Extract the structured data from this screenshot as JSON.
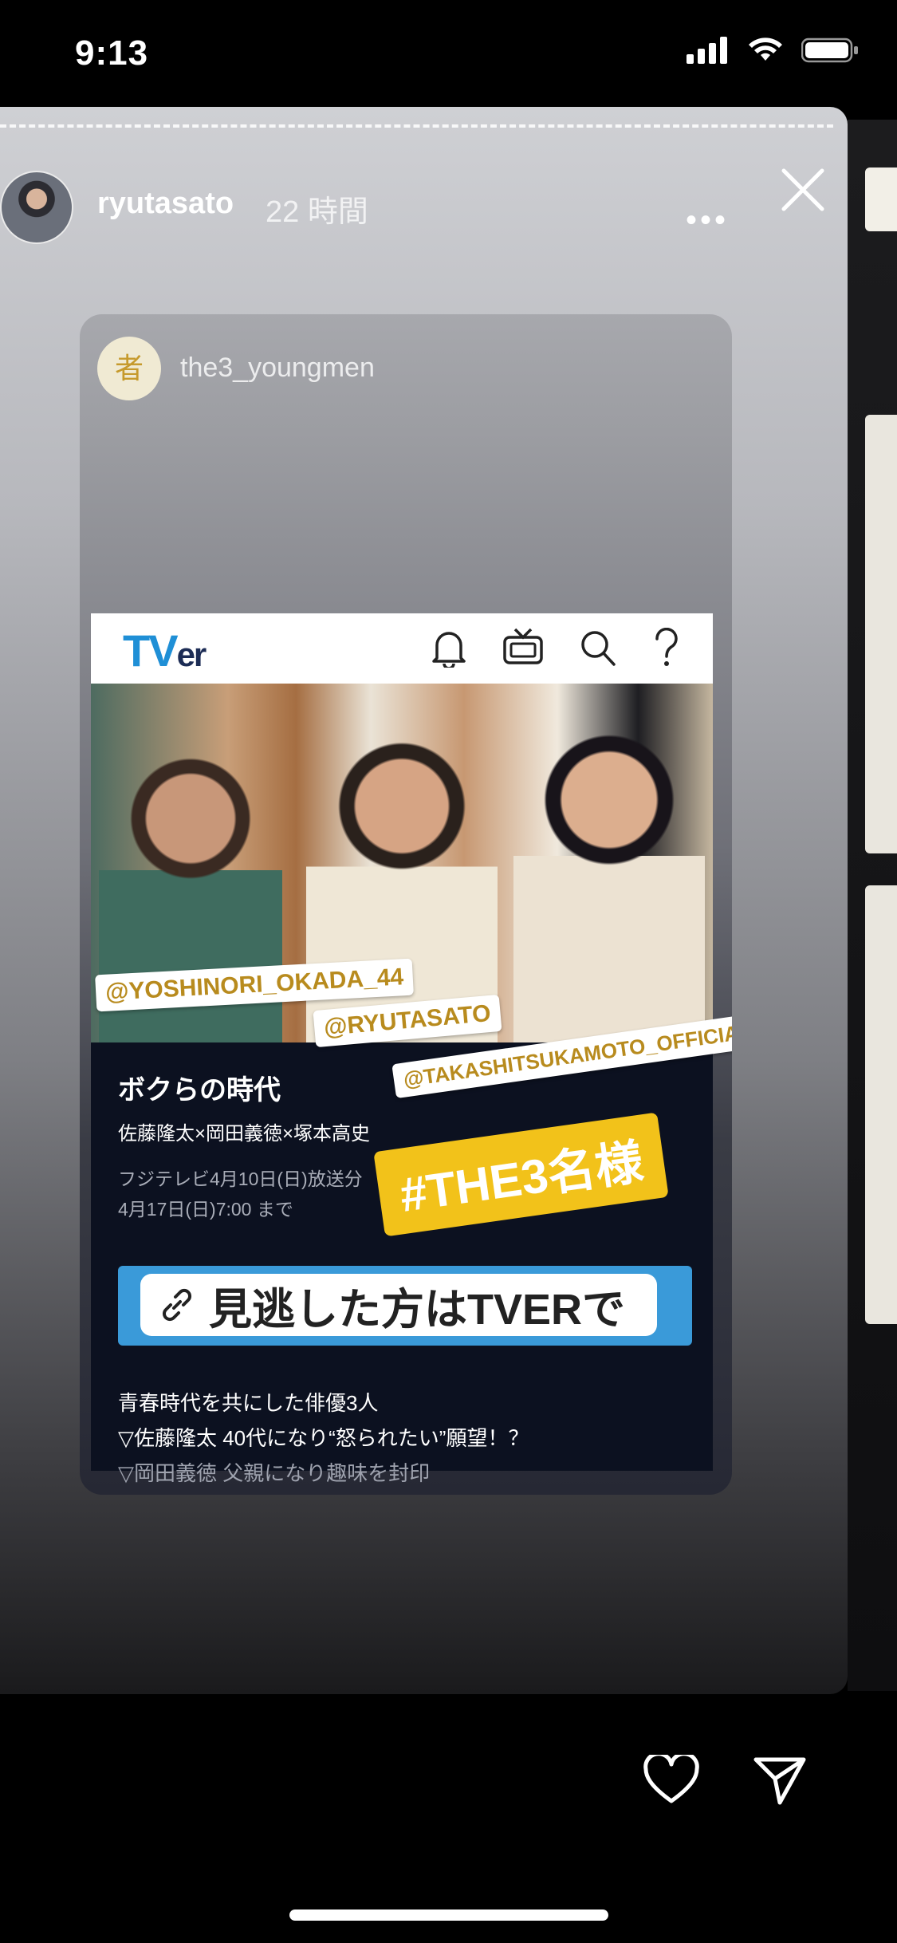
{
  "status_bar": {
    "time": "9:13"
  },
  "story": {
    "username": "ryutasato",
    "elapsed": "22 時間",
    "more_label": "•••"
  },
  "shared_post": {
    "account": "the3_youngmen",
    "account_avatar_glyph": "者"
  },
  "tver": {
    "logo_main": "TV",
    "logo_sub": "er",
    "icons": [
      "bell-icon",
      "tv-icon",
      "search-icon",
      "help-icon"
    ],
    "tags": [
      "@YOSHINORI_OKADA_44",
      "@RYUTASATO",
      "@TAKASHITSUKAMOTO_OFFICIAL"
    ],
    "show_title": "ボクらの時代",
    "cast": "佐藤隆太×岡田義徳×塚本高史",
    "broadcast_line1": "フジテレビ4月10日(日)放送分",
    "broadcast_line2": "4月17日(日)7:00 まで",
    "hashtag": "#THE3名様",
    "link_text": "見逃した方はTVERで",
    "description": [
      "青春時代を共にした俳優3人",
      "▽佐藤隆太 40代になり“怒られたい”願望！？",
      "▽岡田義徳 父親になり趣味を封印"
    ]
  },
  "colors": {
    "tver_blue": "#1f8fd6",
    "hashtag_yellow": "#f2c21a",
    "link_blue": "#3a9ad9"
  }
}
